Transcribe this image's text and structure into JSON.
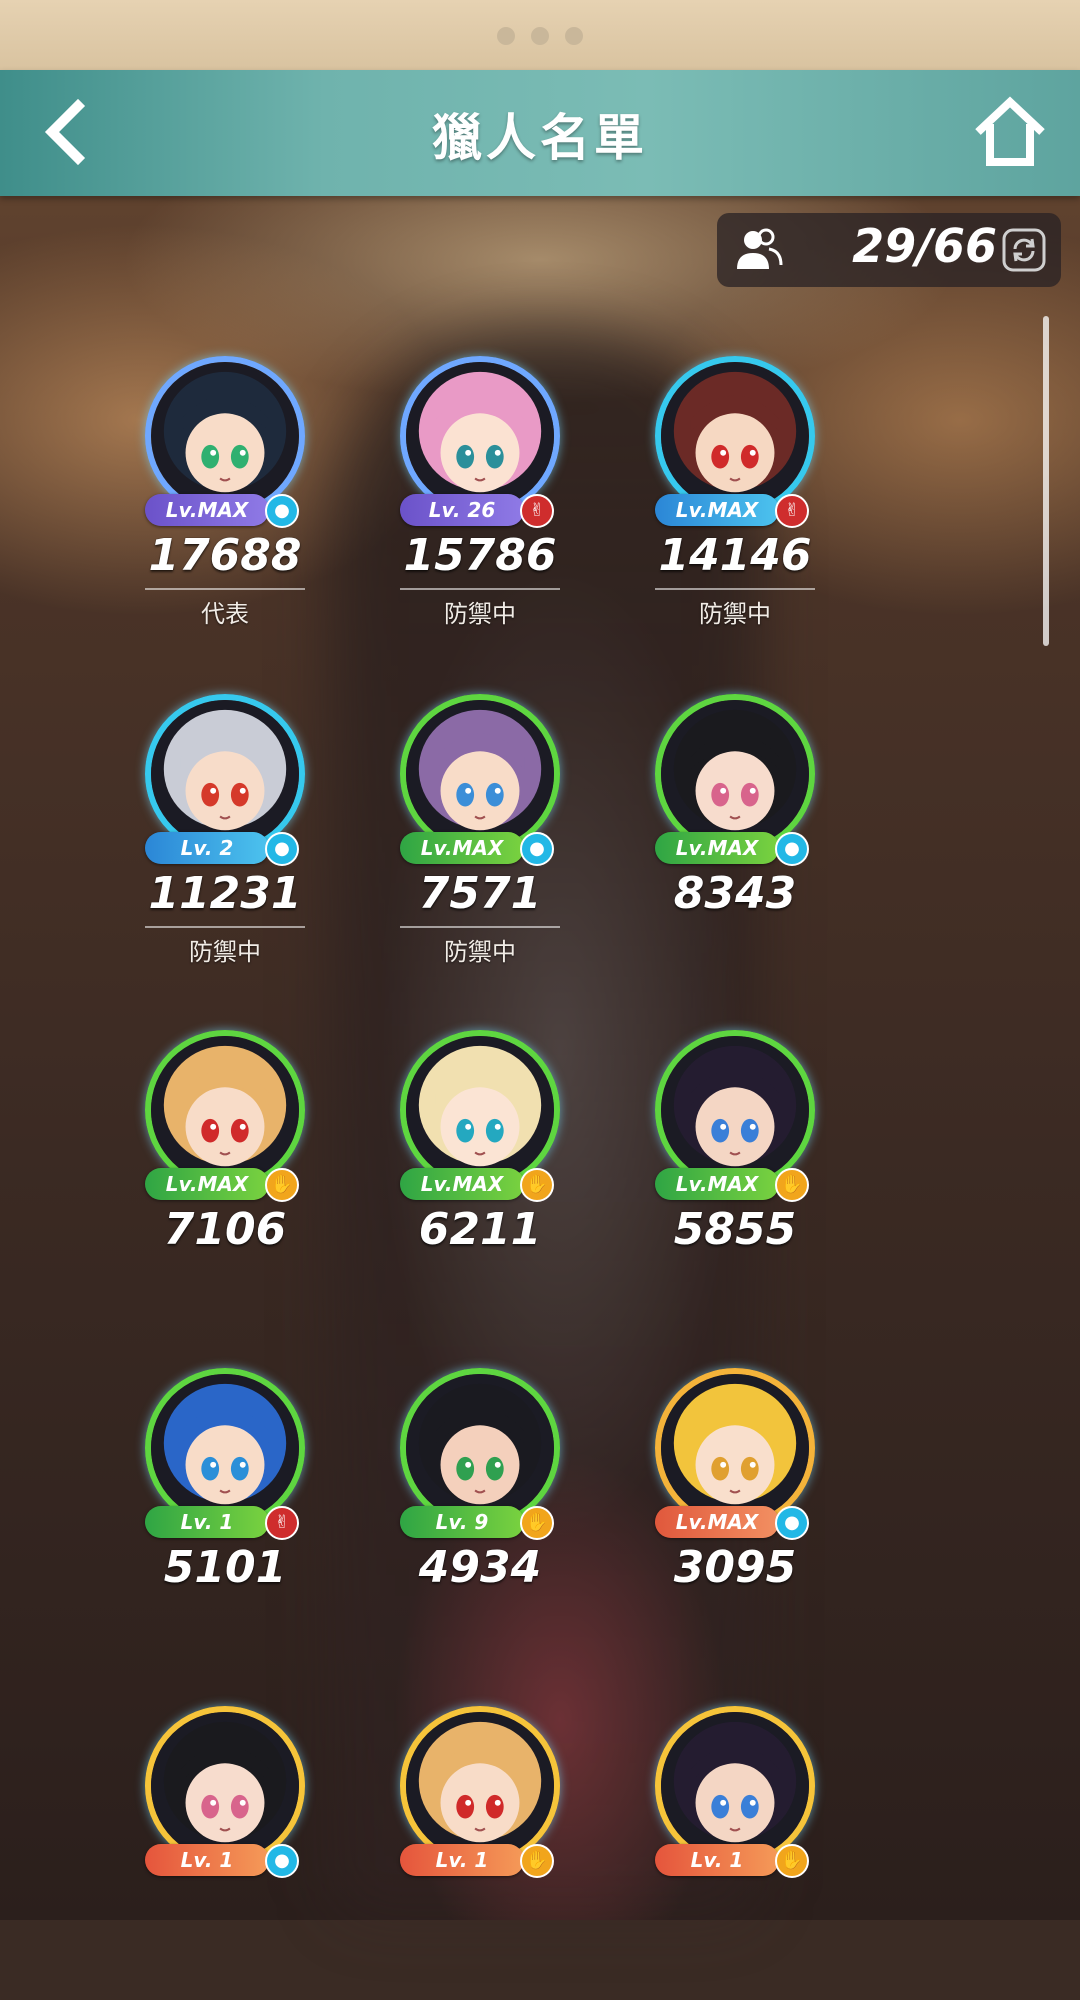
{
  "header": {
    "title": "獵人名單",
    "back_icon": "back-arrow-icon",
    "home_icon": "home-icon"
  },
  "counter": {
    "value": "29/66",
    "icon": "users-icon",
    "refresh_icon": "refresh-icon"
  },
  "colors": {
    "header": "#6fb3ad",
    "scissors": "#cf2d2d",
    "paper": "#f1a51c",
    "rock": "#22b8e6"
  },
  "hunters": [
    {
      "level": "Lv.MAX",
      "rps": "rock",
      "rps_icon": "rock-icon",
      "tier": "purple",
      "power": "17688",
      "status": "代表",
      "hair": "#1e2a3c",
      "skin": "#f8dcc8",
      "eye": "#2fb070"
    },
    {
      "level": "Lv. 26",
      "rps": "scissors",
      "rps_icon": "scissors-icon",
      "tier": "purple",
      "power": "15786",
      "status": "防禦中",
      "hair": "#e99ac6",
      "skin": "#fbe2d2",
      "eye": "#2b8f9a"
    },
    {
      "level": "Lv.MAX",
      "rps": "scissors",
      "rps_icon": "scissors-icon",
      "tier": "blue",
      "power": "14146",
      "status": "防禦中",
      "hair": "#6b2a26",
      "skin": "#f6d8c2",
      "eye": "#d02a2a"
    },
    {
      "level": "Lv. 2",
      "rps": "rock",
      "rps_icon": "rock-icon",
      "tier": "blue",
      "power": "11231",
      "status": "防禦中",
      "hair": "#c9ccd6",
      "skin": "#f7dcc9",
      "eye": "#d5392a"
    },
    {
      "level": "Lv.MAX",
      "rps": "rock",
      "rps_icon": "rock-icon",
      "tier": "green",
      "power": "7571",
      "status": "防禦中",
      "hair": "#8b6aa6",
      "skin": "#f8dcc8",
      "eye": "#3b8ed8"
    },
    {
      "level": "Lv.MAX",
      "rps": "rock",
      "rps_icon": "rock-icon",
      "tier": "green",
      "power": "8343",
      "status": "",
      "hair": "#1a1a1e",
      "skin": "#f7dccd",
      "eye": "#d8648c"
    },
    {
      "level": "Lv.MAX",
      "rps": "paper",
      "rps_icon": "paper-icon",
      "tier": "green",
      "power": "7106",
      "status": "",
      "hair": "#e8b36a",
      "skin": "#f8dcc8",
      "eye": "#d02a2a"
    },
    {
      "level": "Lv.MAX",
      "rps": "paper",
      "rps_icon": "paper-icon",
      "tier": "green",
      "power": "6211",
      "status": "",
      "hair": "#f1e0b0",
      "skin": "#fbe4d4",
      "eye": "#24a8c0"
    },
    {
      "level": "Lv.MAX",
      "rps": "paper",
      "rps_icon": "paper-icon",
      "tier": "green",
      "power": "5855",
      "status": "",
      "hair": "#241c30",
      "skin": "#f4d6c4",
      "eye": "#3a7fd8"
    },
    {
      "level": "Lv. 1",
      "rps": "scissors",
      "rps_icon": "scissors-icon",
      "tier": "green",
      "power": "5101",
      "status": "",
      "hair": "#2a66c8",
      "skin": "#f8dcc8",
      "eye": "#2b8fd8"
    },
    {
      "level": "Lv. 9",
      "rps": "paper",
      "rps_icon": "paper-icon",
      "tier": "green",
      "power": "4934",
      "status": "",
      "hair": "#1a1a20",
      "skin": "#f4d0bc",
      "eye": "#2fa050"
    },
    {
      "level": "Lv.MAX",
      "rps": "rock",
      "rps_icon": "rock-icon",
      "tier": "orange",
      "power": "3095",
      "status": "",
      "hair": "#f2c43c",
      "skin": "#f9dfcc",
      "eye": "#e0a030"
    },
    {
      "level": "Lv. 1",
      "rps": "rock",
      "rps_icon": "rock-icon",
      "tier": "yellow",
      "power": "",
      "status": "",
      "hair": "#1a1a1e",
      "skin": "#f7dccd",
      "eye": "#d8648c"
    },
    {
      "level": "Lv. 1",
      "rps": "paper",
      "rps_icon": "paper-icon",
      "tier": "yellow",
      "power": "",
      "status": "",
      "hair": "#e8b36a",
      "skin": "#f8dcc8",
      "eye": "#d02a2a"
    },
    {
      "level": "Lv. 1",
      "rps": "paper",
      "rps_icon": "paper-icon",
      "tier": "yellow",
      "power": "",
      "status": "",
      "hair": "#241c30",
      "skin": "#f4d6c4",
      "eye": "#3a7fd8"
    }
  ]
}
